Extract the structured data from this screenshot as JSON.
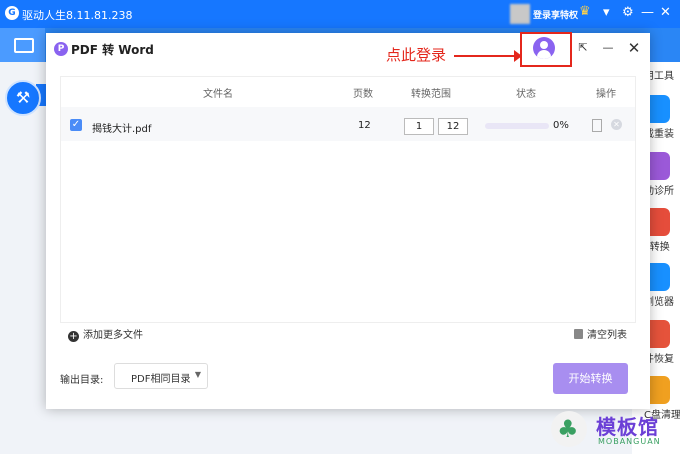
{
  "app": {
    "title": "驱动人生8.11.81.238",
    "vip_text": "登录享特权",
    "right_items": [
      {
        "label": "用工具",
        "color": "#ffffff"
      },
      {
        "label": "载重装",
        "color": "#1890ff"
      },
      {
        "label": "动诊所",
        "color": "#9b59d8"
      },
      {
        "label": "F转换",
        "color": "#e54d3b"
      },
      {
        "label": "浏览器",
        "color": "#1890ff"
      },
      {
        "label": "件恢复",
        "color": "#e5533b"
      },
      {
        "label": "C盘清理",
        "color": "#f0a020"
      }
    ]
  },
  "dialog": {
    "title": "PDF 转 Word",
    "annotation": "点此登录",
    "columns": {
      "filename": "文件名",
      "pages": "页数",
      "range": "转换范围",
      "status": "状态",
      "action": "操作"
    },
    "files": [
      {
        "name": "揭钱大计.pdf",
        "pages": "12",
        "range_from": "1",
        "range_to": "12",
        "progress": 0,
        "progress_text": "0%"
      }
    ],
    "add_more": "添加更多文件",
    "clear_list": "清空列表",
    "output_label": "输出目录:",
    "output_option": "PDF相同目录",
    "start_button": "开始转换"
  },
  "watermark": {
    "text": "模板馆",
    "sub": "MOBANGUAN"
  },
  "colors": {
    "app_blue": "#1677ff",
    "accent_purple": "#8a63f0",
    "annotation_red": "#e4271c",
    "start_button": "#a88ef0"
  }
}
